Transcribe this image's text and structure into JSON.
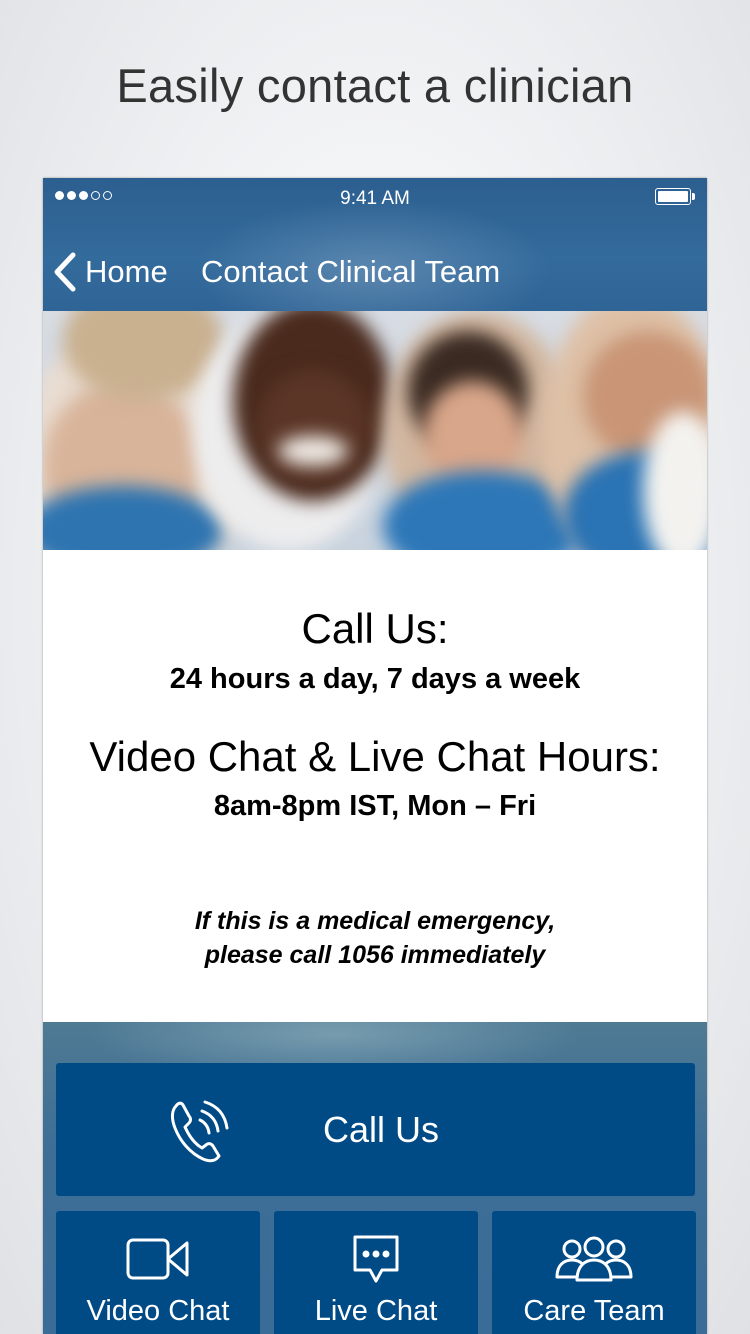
{
  "promo": {
    "title": "Easily contact a clinician"
  },
  "status_bar": {
    "time": "9:41 AM",
    "signal_icon": "signal-dots-icon",
    "battery_icon": "battery-icon"
  },
  "nav": {
    "back_label": "Home",
    "back_icon": "chevron-left-icon",
    "title": "Contact Clinical Team"
  },
  "hero": {
    "image": "clinical-team-photo"
  },
  "info": {
    "call_heading": "Call Us:",
    "call_hours": "24 hours a day, 7 days a week",
    "chat_heading": "Video Chat & Live Chat Hours:",
    "chat_hours": "8am-8pm IST, Mon – Fri",
    "emergency_line1": "If this is a medical emergency,",
    "emergency_line2": "please call 1056 immediately"
  },
  "actions": {
    "call_us": {
      "label": "Call Us",
      "icon": "phone-icon"
    },
    "tiles": [
      {
        "label": "Video Chat",
        "icon": "video-camera-icon"
      },
      {
        "label": "Live Chat",
        "icon": "chat-bubble-icon"
      },
      {
        "label": "Care Team",
        "icon": "people-group-icon"
      }
    ]
  },
  "colors": {
    "nav_bar": "#336b9c",
    "button": "#004a86",
    "text": "#000000"
  }
}
